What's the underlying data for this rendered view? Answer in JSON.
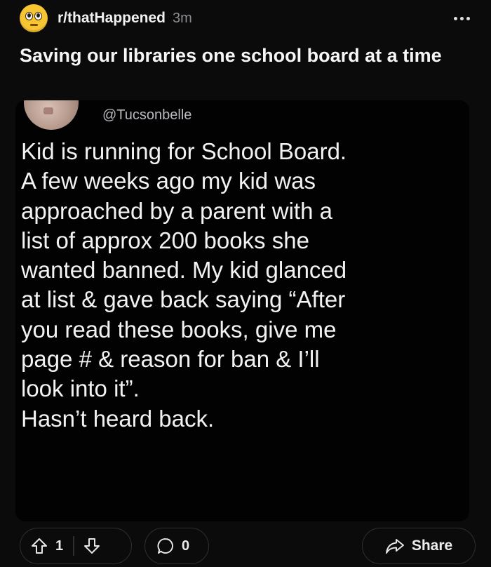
{
  "post": {
    "subreddit": "r/thatHappened",
    "time": "3m",
    "title": "Saving our libraries one school board at a time"
  },
  "tweet": {
    "handle": "@Tucsonbelle",
    "lines": [
      "Kid is running for School Board.",
      "A few weeks ago my kid was",
      "approached by a parent with a",
      "list of approx 200 books she",
      "wanted banned. My kid glanced",
      "at list & gave back saying “After",
      "you read these books, give me",
      "page # & reason for ban & I’ll",
      "look into it”.",
      "Hasn’t heard back."
    ]
  },
  "actions": {
    "upvotes": "1",
    "comments": "0",
    "share_label": "Share"
  },
  "icons": {
    "subreddit_avatar": "flushed-face-icon",
    "more": "more-options-icon",
    "upvote": "upvote-arrow-icon",
    "downvote": "downvote-arrow-icon",
    "comment": "comment-bubble-icon",
    "share": "share-arrow-icon"
  },
  "colors": {
    "background": "#0b0b0c",
    "avatar_yellow": "#f7c531",
    "pill_border": "#2f2f33"
  }
}
